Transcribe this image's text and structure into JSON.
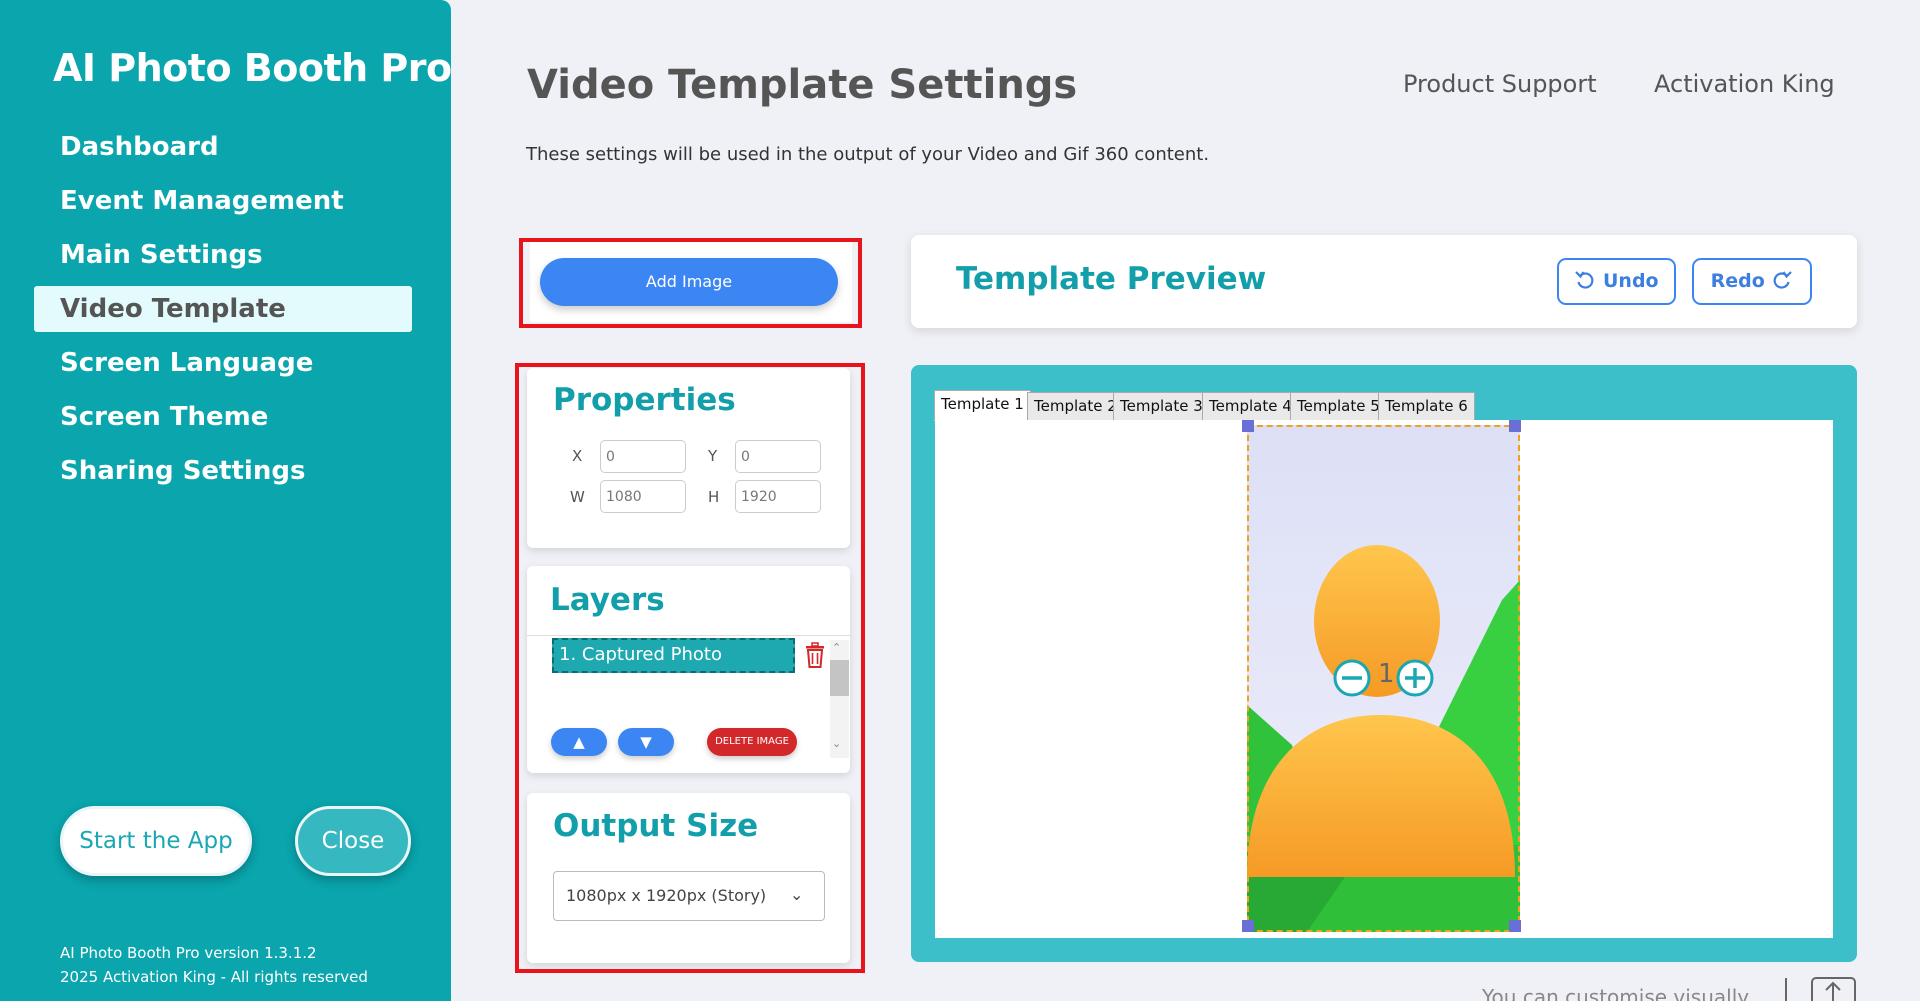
{
  "sidebar": {
    "app_title": "AI Photo Booth Pro",
    "nav": [
      {
        "label": "Dashboard"
      },
      {
        "label": "Event Management"
      },
      {
        "label": "Main Settings"
      },
      {
        "label": "Video Template"
      },
      {
        "label": "Screen Language"
      },
      {
        "label": "Screen Theme"
      },
      {
        "label": "Sharing Settings"
      }
    ],
    "active_nav": "Video Template",
    "start_button": "Start the App",
    "close_button": "Close",
    "version": "AI Photo Booth Pro version 1.3.1.2",
    "copyright": "2025 Activation King - All rights reserved"
  },
  "header": {
    "title": "Video Template Settings",
    "links": [
      "Product Support",
      "Activation King"
    ],
    "subtitle": "These settings will be used in the output of your Video and Gif 360 content."
  },
  "add_image": {
    "label": "Add Image"
  },
  "properties": {
    "title": "Properties",
    "x_label": "X",
    "x_value": "0",
    "y_label": "Y",
    "y_value": "0",
    "w_label": "W",
    "w_value": "1080",
    "h_label": "H",
    "h_value": "1920"
  },
  "layers": {
    "title": "Layers",
    "items": [
      "1. Captured Photo"
    ],
    "up_label": "▲",
    "down_label": "▼",
    "delete_label": "DELETE IMAGE"
  },
  "output_size": {
    "title": "Output Size",
    "selected": "1080px x 1920px (Story)"
  },
  "preview": {
    "title": "Template Preview",
    "undo_label": "Undo",
    "redo_label": "Redo",
    "tabs": [
      "Template 1",
      "Template 2",
      "Template 3",
      "Template 4",
      "Template 5",
      "Template 6"
    ],
    "active_tab": "Template 1",
    "zoom_value": "1"
  },
  "hint": "You can customise visually",
  "colors": {
    "sidebar_bg": "#0aa5ad",
    "accent_teal": "#129faa",
    "primary_blue": "#3c86f3",
    "danger_red": "#d2282a",
    "highlight_red": "#e8141c"
  }
}
